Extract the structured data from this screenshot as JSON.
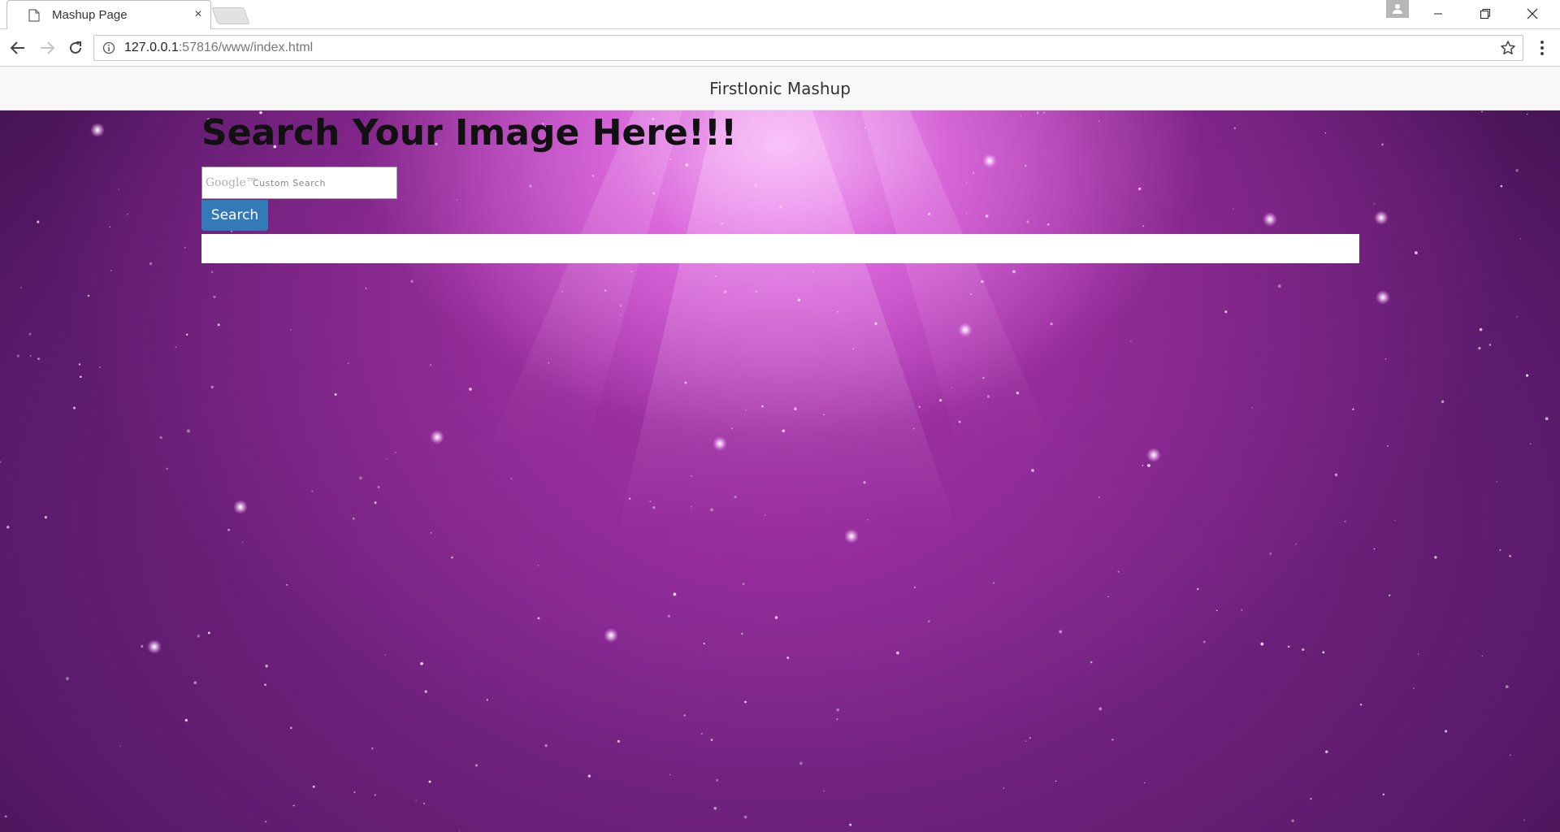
{
  "browser": {
    "tab_title": "Mashup Page",
    "tab_close": "×",
    "url_host": "127.0.0.1",
    "url_rest": ":57816/www/index.html"
  },
  "page": {
    "navbar_title": "FirstIonic Mashup",
    "heading": "Search Your Image Here!!!",
    "search_brand": "Google™",
    "search_placeholder": "Custom Search",
    "search_button": "Search"
  },
  "colors": {
    "search_button": "#337ab7",
    "navbar_bg": "#f8f8f8",
    "background_purple": "#8a2c96"
  }
}
